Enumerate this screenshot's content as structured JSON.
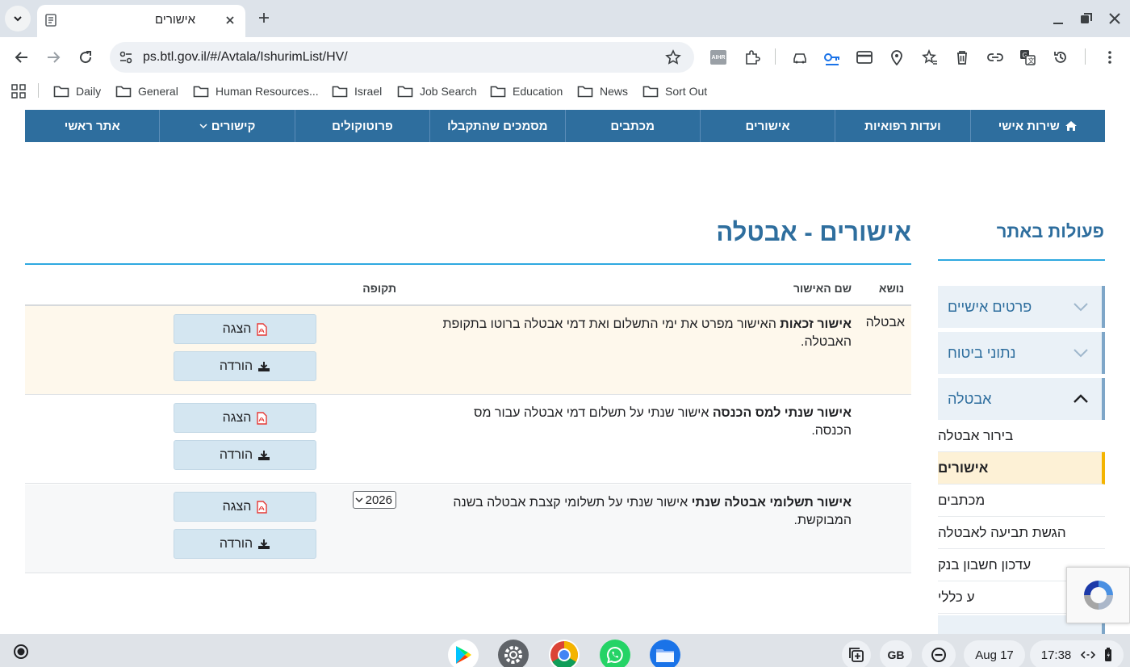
{
  "browser": {
    "tab_title": "אישורים",
    "url": "ps.btl.gov.il/#/Avtala/IshurimList/HV/",
    "extension_aihr": "AIHR",
    "bookmarks": [
      "Daily",
      "General",
      "Human Resources...",
      "Israel",
      "Job Search",
      "Education",
      "News",
      "Sort Out"
    ]
  },
  "site_nav": {
    "items": [
      "שירות אישי",
      "ועדות רפואיות",
      "אישורים",
      "מכתבים",
      "מסמכים שהתקבלו",
      "פרוטוקולים",
      "קישורים",
      "אתר ראשי"
    ]
  },
  "sidebar": {
    "title": "פעולות באתר",
    "accordions": [
      "פרטים אישיים",
      "נתוני ביטוח",
      "אבטלה"
    ],
    "sub_items": [
      "בירור אבטלה",
      "אישורים",
      "מכתבים",
      "הגשת תביעה לאבטלה",
      "עדכון חשבון בנק",
      "ע כללי"
    ]
  },
  "main": {
    "title": "אישורים - אבטלה",
    "headers": {
      "topic": "נושא",
      "name": "שם האישור",
      "period": "תקופה"
    },
    "rows": [
      {
        "topic": "אבטלה",
        "name_bold": "אישור זכאות",
        "name_rest": " האישור מפרט את ימי התשלום ואת דמי אבטלה ברוטו בתקופת האבטלה.",
        "period": ""
      },
      {
        "topic": "",
        "name_bold": "אישור שנתי למס הכנסה",
        "name_rest": " אישור שנתי על תשלום דמי אבטלה עבור מס הכנסה.",
        "period": ""
      },
      {
        "topic": "",
        "name_bold": "אישור תשלומי אבטלה שנתי",
        "name_rest": " אישור שנתי על תשלומי קצבת אבטלה בשנה המבוקשת.",
        "period": "2026"
      }
    ],
    "view_label": "הצגה",
    "download_label": "הורדה"
  },
  "shelf": {
    "locale": "GB",
    "date": "Aug 17",
    "time": "17:38"
  },
  "colors": {
    "brand_blue": "#2e6e9e",
    "accent_line": "#2fa9e0",
    "highlight_row": "#fef8ec",
    "active_sidebar": "#fdf1d6",
    "active_border": "#f4b400"
  }
}
